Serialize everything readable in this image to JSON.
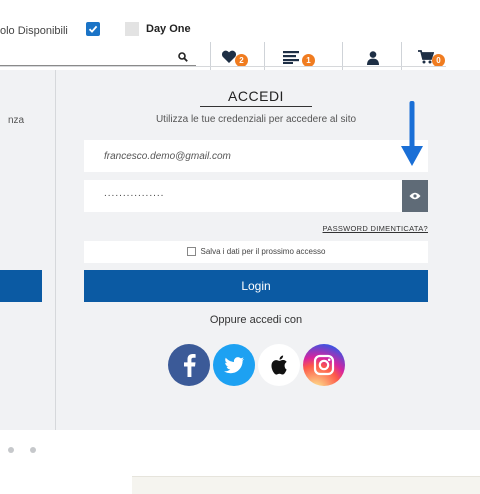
{
  "filters": {
    "available_label": "olo Disponibili",
    "available_checked": true,
    "dayone_label": "Day One",
    "dayone_checked": false
  },
  "header": {
    "wishlist_badge": "2",
    "list_badge": "1",
    "cart_badge": "0",
    "icons": [
      "search-icon",
      "heart-icon",
      "list-icon",
      "user-icon",
      "cart-icon"
    ]
  },
  "left_panel": {
    "partial_text": "nza"
  },
  "login": {
    "title": "ACCEDI",
    "subtitle": "Utilizza le tue credenziali per accedere al sito",
    "email_value": "francesco.demo@gmail.com",
    "password_mask": "................",
    "forgot_link": "PASSWORD DIMENTICATA?",
    "remember_label": "Salva i dati per il prossimo accesso",
    "remember_checked": false,
    "login_button": "Login",
    "alt_login": "Oppure accedi con",
    "social": [
      "facebook-icon",
      "twitter-icon",
      "apple-icon",
      "instagram-icon"
    ]
  },
  "colors": {
    "primary": "#0b5aa3",
    "badge": "#f07c20",
    "panel_bg": "#f1f2f4",
    "arrow": "#1a6fd6"
  }
}
